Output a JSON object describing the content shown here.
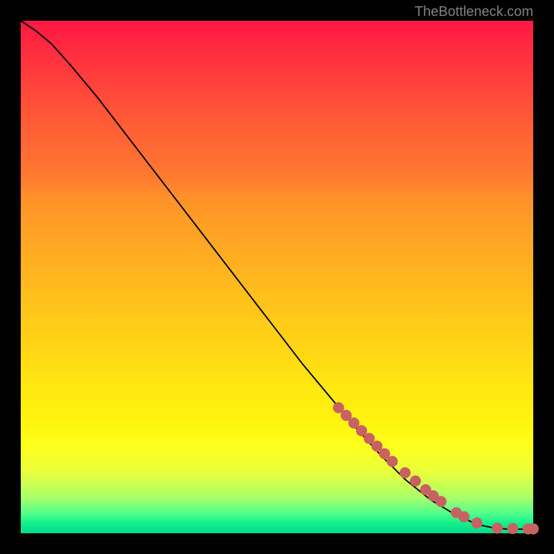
{
  "attribution": "TheBottleneck.com",
  "chart_data": {
    "type": "line",
    "title": "",
    "xlabel": "",
    "ylabel": "",
    "xlim": [
      0,
      100
    ],
    "ylim": [
      0,
      100
    ],
    "line": {
      "name": "bottleneck-curve",
      "x": [
        0,
        3,
        6,
        10,
        15,
        20,
        25,
        30,
        35,
        40,
        45,
        50,
        55,
        60,
        65,
        70,
        75,
        80,
        85,
        88,
        90,
        92,
        95,
        98,
        100
      ],
      "y": [
        100,
        98,
        95.5,
        91,
        85,
        78.5,
        72,
        65.5,
        59,
        52.5,
        46,
        39.5,
        33,
        27,
        21,
        15.5,
        10.5,
        6.5,
        3.5,
        2.2,
        1.5,
        1.1,
        0.8,
        0.8,
        0.8
      ]
    },
    "markers": {
      "name": "scatter-points",
      "color": "#c86262",
      "x": [
        62,
        63.5,
        65,
        66.5,
        68,
        69.5,
        71,
        72.5,
        75,
        77,
        79,
        80.5,
        82,
        85,
        86.5,
        89,
        93,
        96,
        99,
        100
      ],
      "y": [
        24.5,
        23,
        21.5,
        20,
        18.5,
        17,
        15.5,
        14,
        11.8,
        10.2,
        8.5,
        7.3,
        6.2,
        4.0,
        3.2,
        2.0,
        1.0,
        0.9,
        0.85,
        0.85
      ]
    }
  }
}
